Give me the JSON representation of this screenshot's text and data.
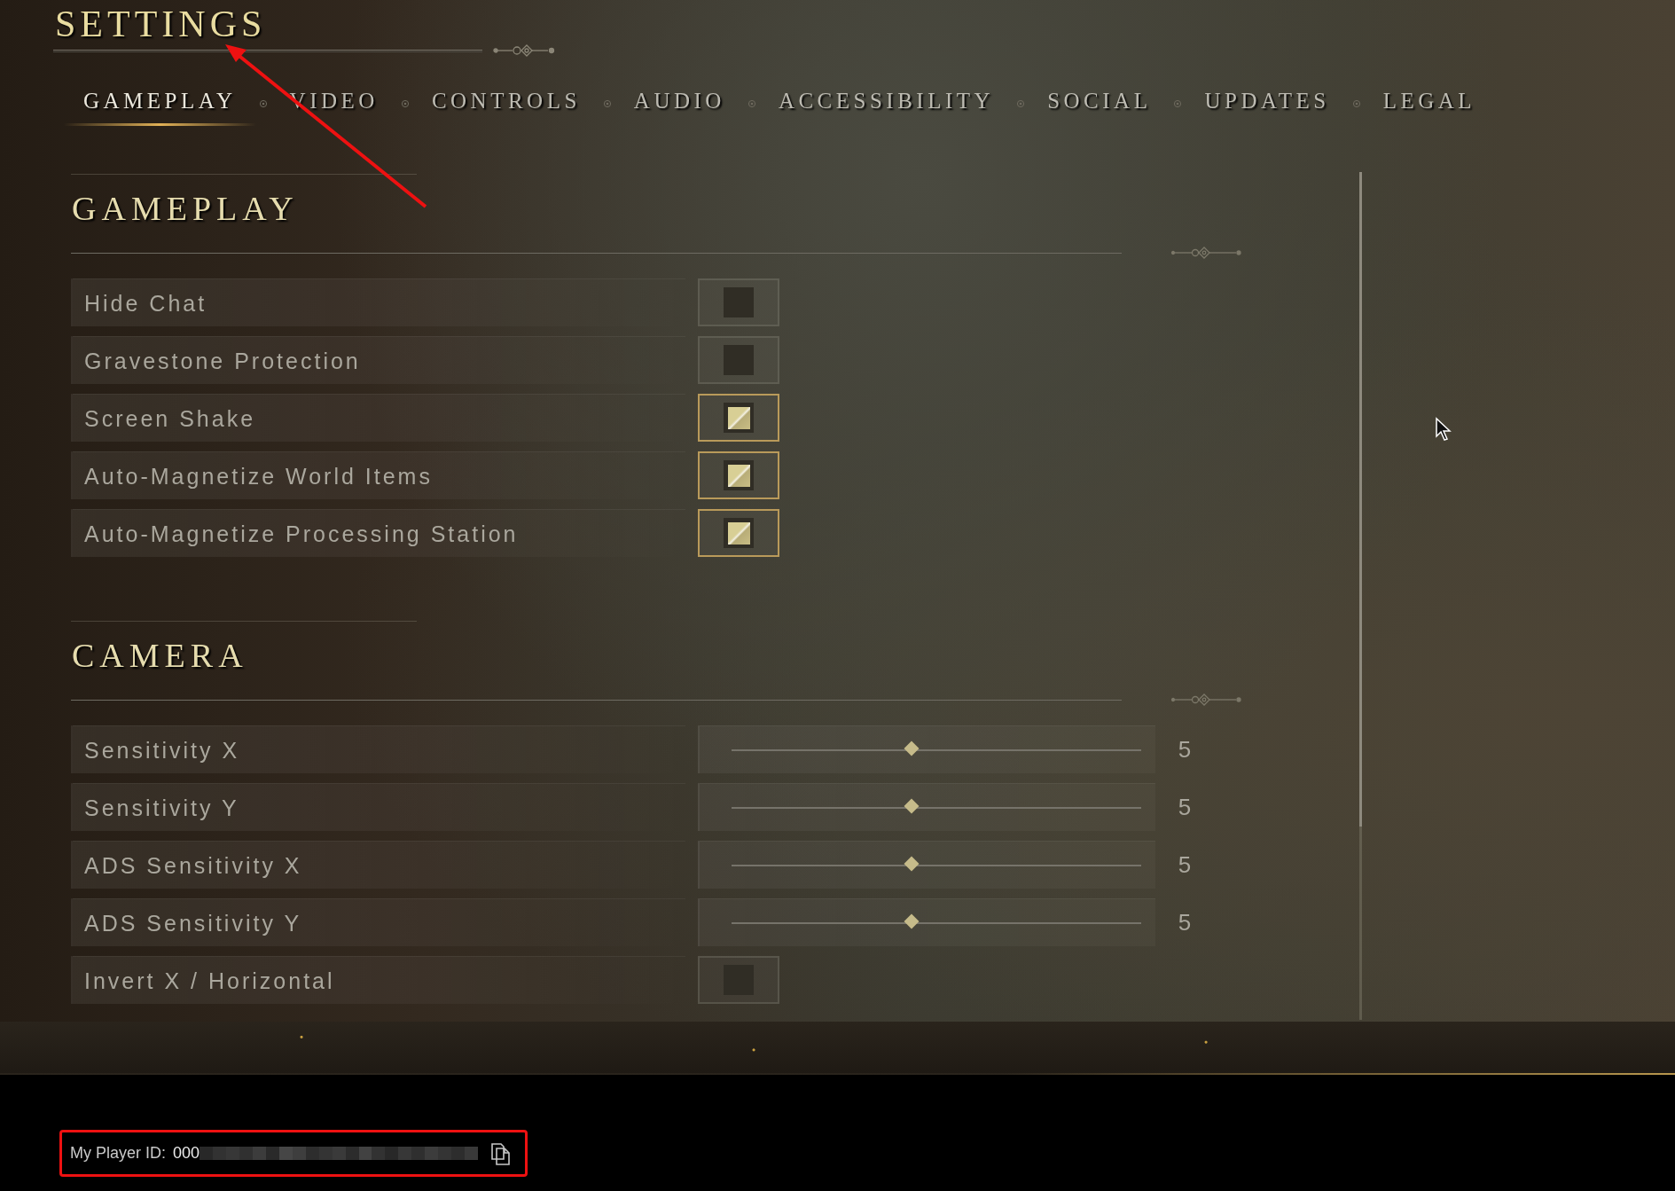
{
  "title": {
    "text": "SETTINGS",
    "annotation": {
      "kind": "arrow"
    }
  },
  "tabs": [
    {
      "label": "GAMEPLAY",
      "selected": true
    },
    {
      "label": "VIDEO",
      "selected": false
    },
    {
      "label": "CONTROLS",
      "selected": false
    },
    {
      "label": "AUDIO",
      "selected": false
    },
    {
      "label": "ACCESSIBILITY",
      "selected": false
    },
    {
      "label": "SOCIAL",
      "selected": false
    },
    {
      "label": "UPDATES",
      "selected": false
    },
    {
      "label": "LEGAL",
      "selected": false
    }
  ],
  "sections": [
    {
      "heading": "GAMEPLAY",
      "settings": [
        {
          "kind": "toggle",
          "label": "Hide Chat",
          "checked": false
        },
        {
          "kind": "toggle",
          "label": "Gravestone Protection",
          "checked": false
        },
        {
          "kind": "toggle",
          "label": "Screen Shake",
          "checked": true
        },
        {
          "kind": "toggle",
          "label": "Auto-Magnetize World Items",
          "checked": true
        },
        {
          "kind": "toggle",
          "label": "Auto-Magnetize Processing Station",
          "checked": true
        }
      ]
    },
    {
      "heading": "CAMERA",
      "settings": [
        {
          "kind": "slider",
          "label": "Sensitivity X",
          "level": 0.44,
          "reading": "5"
        },
        {
          "kind": "slider",
          "label": "Sensitivity Y",
          "level": 0.44,
          "reading": "5"
        },
        {
          "kind": "slider",
          "label": "ADS Sensitivity X",
          "level": 0.44,
          "reading": "5"
        },
        {
          "kind": "slider",
          "label": "ADS Sensitivity Y",
          "level": 0.44,
          "reading": "5"
        },
        {
          "kind": "toggle",
          "label": "Invert X / Horizontal",
          "checked": false
        }
      ]
    }
  ],
  "player_id": {
    "label": "My Player ID:",
    "value": "000",
    "annotation": {
      "kind": "highlight_box"
    }
  }
}
